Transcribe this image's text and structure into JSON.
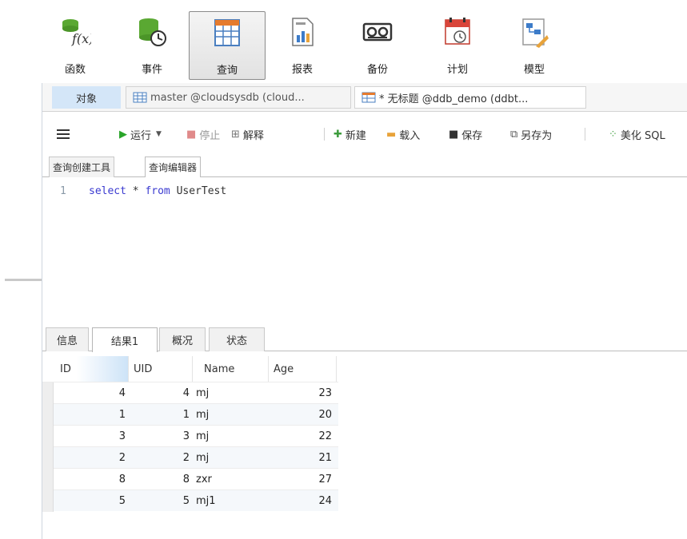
{
  "ribbon": {
    "items": [
      {
        "label": "函数",
        "icon": "function-icon"
      },
      {
        "label": "事件",
        "icon": "event-icon"
      },
      {
        "label": "查询",
        "icon": "query-icon"
      },
      {
        "label": "报表",
        "icon": "report-icon"
      },
      {
        "label": "备份",
        "icon": "backup-icon"
      },
      {
        "label": "计划",
        "icon": "schedule-icon"
      },
      {
        "label": "模型",
        "icon": "model-icon"
      }
    ]
  },
  "doc_tabs": {
    "objects": "对象",
    "tab2": "master @cloudsysdb (cloud...",
    "tab3": "* 无标题 @ddb_demo (ddbt..."
  },
  "toolbar": {
    "run": "运行",
    "stop": "停止",
    "explain": "解释",
    "new": "新建",
    "load": "载入",
    "save": "保存",
    "save_as": "另存为",
    "beautify": "美化 SQL"
  },
  "mode_tabs": {
    "builder": "查询创建工具",
    "editor": "查询编辑器"
  },
  "editor": {
    "line_number": "1",
    "kw_select": "select",
    "star": "*",
    "kw_from": "from",
    "table": "UserTest"
  },
  "result_tabs": [
    "信息",
    "结果1",
    "概况",
    "状态"
  ],
  "grid": {
    "columns": [
      "ID",
      "UID",
      "Name",
      "Age"
    ],
    "rows": [
      [
        "4",
        "4",
        "mj",
        "23"
      ],
      [
        "1",
        "1",
        "mj",
        "20"
      ],
      [
        "3",
        "3",
        "mj",
        "22"
      ],
      [
        "2",
        "2",
        "mj",
        "21"
      ],
      [
        "8",
        "8",
        "zxr",
        "27"
      ],
      [
        "5",
        "5",
        "mj1",
        "24"
      ]
    ]
  },
  "colors": {
    "accent_tab": "#d4e6f8",
    "run_green": "#2aa52a",
    "stop_red": "#d9534f",
    "keyword": "#3a3ad0"
  }
}
